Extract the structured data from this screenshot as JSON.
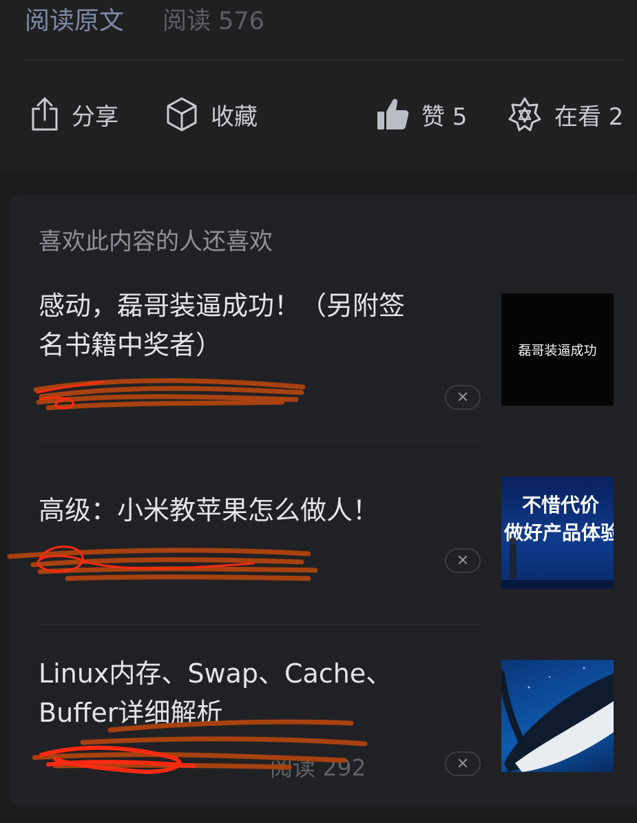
{
  "header": {
    "read_original": "阅读原文",
    "read_count": "阅读 576"
  },
  "actions": {
    "share": "分享",
    "favorite": "收藏",
    "like": "赞 5",
    "watching": "在看 2"
  },
  "recommend": {
    "title": "喜欢此内容的人还喜欢",
    "items": [
      {
        "title_line1": "感动，磊哥装逼成功！（另附签",
        "title_line2": "名书籍中奖者）",
        "meta": "",
        "thumb_text": "磊哥装逼成功",
        "thumb_bg": "#050505"
      },
      {
        "title_line1": "高级：小米教苹果怎么做人！",
        "meta": "",
        "thumb_text_1": "不惜代价",
        "thumb_text_2": "做好产品体验",
        "thumb_bg": "#0b2f78"
      },
      {
        "title_line1": "Linux内存、Swap、Cache、",
        "title_line2": "Buffer详细解析",
        "meta": "阅读 292",
        "thumb_bg": "#0b3f8a"
      }
    ]
  },
  "colors": {
    "accent_link": "#7c8aa6",
    "scribble_red": "#ff2a12",
    "scribble_brown": "#a8410f"
  }
}
